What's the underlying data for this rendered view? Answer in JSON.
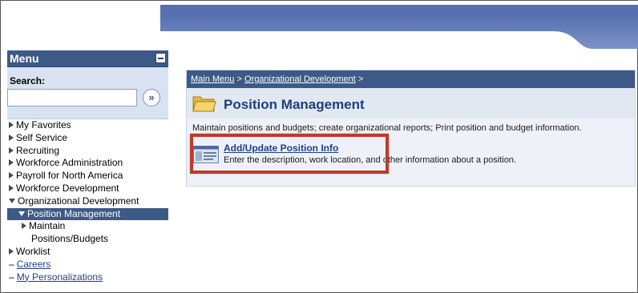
{
  "menu": {
    "title": "Menu",
    "search_label": "Search:",
    "search_value": "",
    "search_go_glyph": "»",
    "items": [
      {
        "label": "My Favorites"
      },
      {
        "label": "Self Service"
      },
      {
        "label": "Recruiting"
      },
      {
        "label": "Workforce Administration"
      },
      {
        "label": "Payroll for North America"
      },
      {
        "label": "Workforce Development"
      },
      {
        "label": "Organizational Development"
      },
      {
        "label": "Position Management"
      },
      {
        "label": "Maintain"
      },
      {
        "label": "Positions/Budgets"
      },
      {
        "label": "Worklist"
      },
      {
        "label": "Careers"
      },
      {
        "label": "My Personalizations"
      }
    ]
  },
  "breadcrumb": {
    "main_menu": "Main Menu",
    "sep1": " > ",
    "org_dev": "Organizational Development",
    "sep2": " >"
  },
  "page": {
    "title": "Position Management",
    "description": "Maintain positions and budgets; create organizational reports; Print position and budget information."
  },
  "item": {
    "label": "Add/Update Position Info",
    "description": "Enter the description, work location, and other information about a position."
  },
  "colors": {
    "menu_header": "#3d5a87",
    "highlight": "#c0392b",
    "link": "#1f3f8c"
  }
}
